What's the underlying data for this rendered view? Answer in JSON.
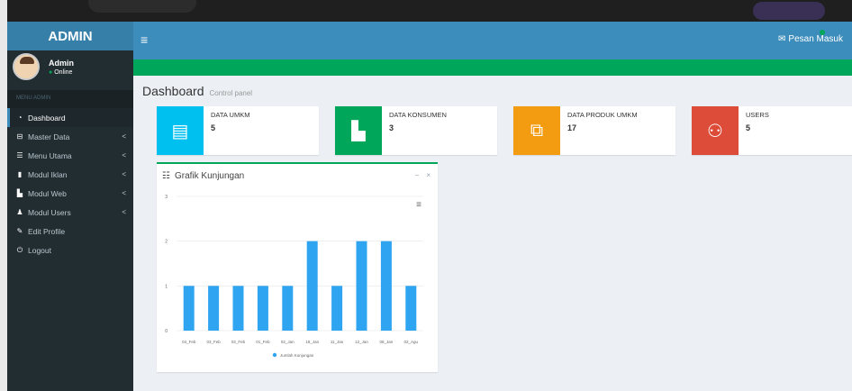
{
  "app": {
    "logo": "ADMIN"
  },
  "user": {
    "name": "Admin",
    "status": "Online"
  },
  "sidebar": {
    "header": "MENU ADMIN",
    "items": [
      {
        "label": "Dashboard",
        "icon": "dashboard-icon",
        "active": true,
        "chevron": ""
      },
      {
        "label": "Master Data",
        "icon": "cart-icon",
        "chevron": "<"
      },
      {
        "label": "Menu Utama",
        "icon": "list-icon",
        "chevron": "<"
      },
      {
        "label": "Modul Iklan",
        "icon": "book-icon",
        "chevron": "<"
      },
      {
        "label": "Modul Web",
        "icon": "server-icon",
        "chevron": "<"
      },
      {
        "label": "Modul Users",
        "icon": "users-icon",
        "chevron": "<"
      },
      {
        "label": "Edit Profile",
        "icon": "edit-icon",
        "chevron": ""
      },
      {
        "label": "Logout",
        "icon": "power-icon",
        "chevron": ""
      }
    ]
  },
  "topbar": {
    "toggle": "≡",
    "message_label": "Pesan Masuk",
    "message_count": ""
  },
  "page": {
    "title": "Dashboard",
    "subtitle": "Control panel"
  },
  "stats": [
    {
      "label": "DATA UMKM",
      "value": "5",
      "color": "#00c0ef",
      "icon": "book-icon"
    },
    {
      "label": "DATA KONSUMEN",
      "value": "3",
      "color": "#00a65a",
      "icon": "file-icon"
    },
    {
      "label": "DATA PRODUK UMKM",
      "value": "17",
      "color": "#f39c12",
      "icon": "files-icon"
    },
    {
      "label": "USERS",
      "value": "5",
      "color": "#dd4b39",
      "icon": "users-icon"
    }
  ],
  "chart_box": {
    "title": "Grafik Kunjungan",
    "minimize": "−",
    "close": "×"
  },
  "chart_data": {
    "type": "bar",
    "categories": [
      "04_Feb",
      "03_Feb",
      "02_Feb",
      "01_Feb",
      "02_Jan",
      "18_Jan",
      "11_Jan",
      "12_Jan",
      "08_Jan",
      "02_Agu"
    ],
    "series": [
      {
        "name": "Jumlah Kunjungan",
        "values": [
          1,
          1,
          1,
          1,
          1,
          2,
          1,
          2,
          2,
          1
        ]
      }
    ],
    "ylim": [
      0,
      3
    ],
    "yticks": [
      0,
      1,
      2,
      3
    ],
    "color": "#2fa4f0",
    "legend": "bottom"
  }
}
